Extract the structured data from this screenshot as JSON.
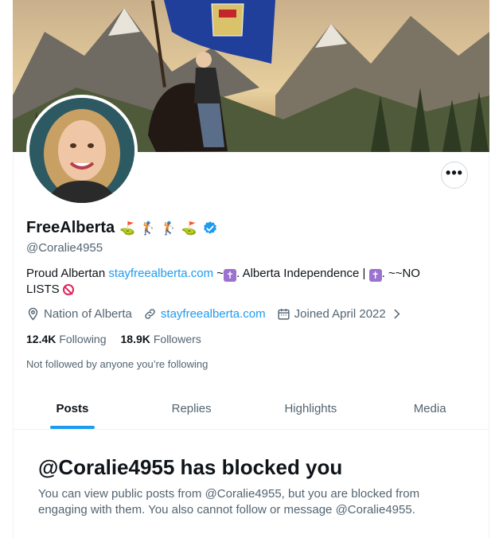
{
  "profile": {
    "display_name": "FreeAlberta",
    "name_emojis": [
      "⛳",
      "🏌",
      "🏌",
      "⛳"
    ],
    "handle": "@Coralie4955",
    "verified_icon": "verified-badge-icon",
    "bio": {
      "text_1": "Proud Albertan ",
      "link": "stayfreealberta.com",
      "text_2": " ~",
      "cross_1": "✝",
      "text_3": ". Alberta Independence |",
      "cross_2": "✝",
      "text_4": ".  ~~NO LISTS"
    },
    "location": "Nation of Alberta",
    "website": "stayfreealberta.com",
    "joined": "Joined April 2022",
    "following_count": "12.4K",
    "following_label": "Following",
    "followers_count": "18.9K",
    "followers_label": "Followers",
    "not_followed_text": "Not followed by anyone you’re following",
    "more_label": "•••"
  },
  "tabs": [
    {
      "label": "Posts",
      "active": true
    },
    {
      "label": "Replies",
      "active": false
    },
    {
      "label": "Highlights",
      "active": false
    },
    {
      "label": "Media",
      "active": false
    }
  ],
  "blocked": {
    "title": "@Coralie4955 has blocked you",
    "description": "You can view public posts from @Coralie4955, but you are blocked from engaging with them. You also cannot follow or message @Coralie4955."
  },
  "colors": {
    "accent": "#1d9bf0",
    "text_primary": "#0f1419",
    "text_secondary": "#536471",
    "border": "#eff3f4"
  }
}
